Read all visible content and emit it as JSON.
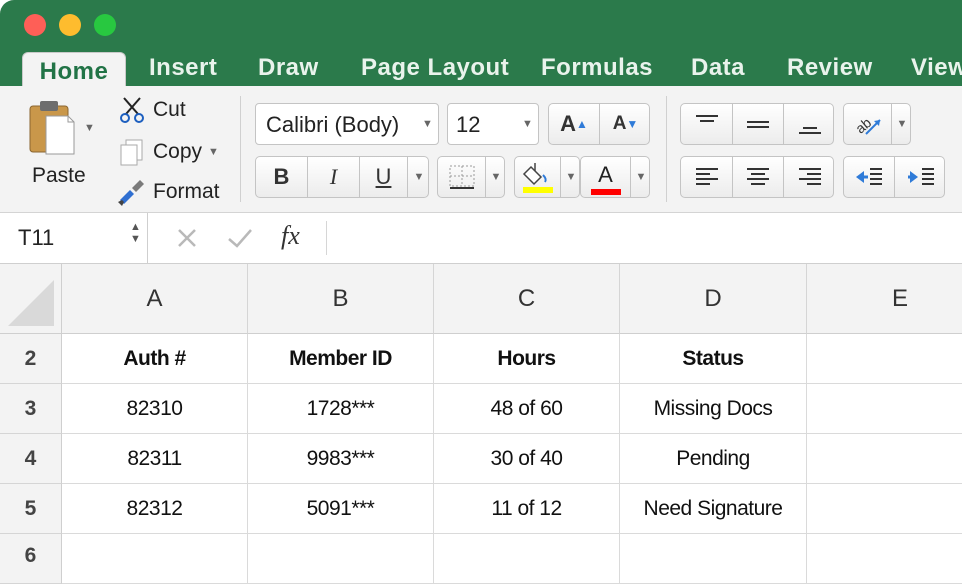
{
  "window": {
    "colors": {
      "ribbon_green": "#2b7a4b",
      "close": "#fe5f57",
      "minimize": "#febc2e",
      "zoom": "#28c840"
    }
  },
  "tabs": [
    "Home",
    "Insert",
    "Draw",
    "Page Layout",
    "Formulas",
    "Data",
    "Review",
    "View"
  ],
  "ribbon": {
    "paste_label": "Paste",
    "cut_label": "Cut",
    "copy_label": "Copy",
    "format_label": "Format",
    "font_name": "Calibri (Body)",
    "font_size": "12",
    "bold": "B",
    "italic": "I",
    "underline": "U",
    "grow_font": "A",
    "shrink_font": "A",
    "font_color_letter": "A",
    "icons": {
      "highlight_color": "#ffff00",
      "font_color": "#ff0000"
    }
  },
  "formula_bar": {
    "name_box": "T11",
    "fx": "fx",
    "value": ""
  },
  "columns": [
    "A",
    "B",
    "C",
    "D",
    "E"
  ],
  "rows": [
    {
      "num": "2",
      "cells": [
        "Auth #",
        "Member ID",
        "Hours",
        "Status",
        ""
      ]
    },
    {
      "num": "3",
      "cells": [
        "82310",
        "1728***",
        "48 of 60",
        "Missing Docs",
        ""
      ]
    },
    {
      "num": "4",
      "cells": [
        "82311",
        "9983***",
        "30 of 40",
        "Pending",
        ""
      ]
    },
    {
      "num": "5",
      "cells": [
        "82312",
        "5091***",
        "11 of 12",
        "Need Signature",
        ""
      ]
    },
    {
      "num": "6",
      "cells": [
        "",
        "",
        "",
        "",
        ""
      ]
    }
  ]
}
